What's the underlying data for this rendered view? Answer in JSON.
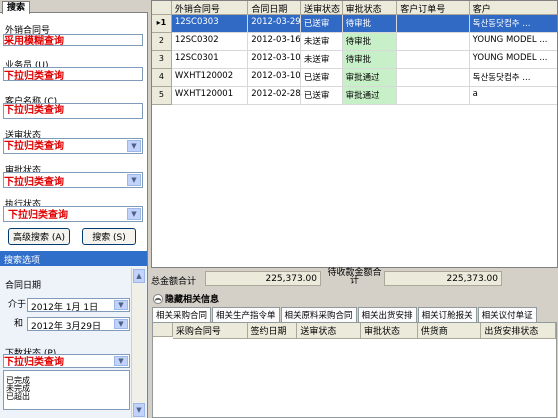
{
  "left": {
    "tab_label": "搜索",
    "fields": [
      {
        "label": "外销合同号",
        "value": "采用模糊查询"
      },
      {
        "label": "业务员 (U)",
        "value": "下拉归类查询"
      },
      {
        "label": "客户名称 (C)",
        "value": "下拉归类查询"
      },
      {
        "label": "送审状态",
        "value": "下拉归类查询"
      },
      {
        "label": "审批状态",
        "value": "下拉归类查询"
      },
      {
        "label": "执行状态",
        "value": "下拉归类查询"
      }
    ],
    "advanced_button": "高级搜索 (A)",
    "search_button": "搜索 (S)",
    "options_header": "搜索选项",
    "contract_date_label": "合同日期",
    "from_label": "介于",
    "from_date": "2012年 1月 1日",
    "to_label": "和",
    "to_date": "2012年 3月29日",
    "order_status_label": "下数状态 (P)",
    "order_status_value": "下拉归类查询",
    "order_status_options": [
      "已完成",
      "未完成",
      "已超出"
    ]
  },
  "grid": {
    "columns": [
      "外销合同号",
      "合同日期",
      "送审状态",
      "审批状态",
      "客户订单号",
      "客户"
    ],
    "rows": [
      {
        "num": "1",
        "contract": "12SC0303",
        "date": "2012-03-29",
        "submit": "已送审",
        "approve": "待审批",
        "order": "",
        "customer": "독산동닷컴추 ...",
        "selected": true
      },
      {
        "num": "2",
        "contract": "12SC0302",
        "date": "2012-03-16",
        "submit": "未送审",
        "approve": "待审批",
        "order": "",
        "customer": "YOUNG MODEL ...",
        "selected": false
      },
      {
        "num": "3",
        "contract": "12SC0301",
        "date": "2012-03-10",
        "submit": "未送审",
        "approve": "待审批",
        "order": "",
        "customer": "YOUNG MODEL ...",
        "selected": false
      },
      {
        "num": "4",
        "contract": "WXHT120002",
        "date": "2012-03-10",
        "submit": "已送审",
        "approve": "审批通过",
        "order": "",
        "customer": "독산동닷컴추 ...",
        "selected": false
      },
      {
        "num": "5",
        "contract": "WXHT120001",
        "date": "2012-02-28",
        "submit": "已送审",
        "approve": "审批通过",
        "order": "",
        "customer": "a",
        "selected": false
      }
    ]
  },
  "totals": {
    "total_label": "总金额合计",
    "total_value": "225,373.00",
    "receivable_label": "待收款金额合计",
    "receivable_value": "225,373.00"
  },
  "related": {
    "toggle_label": "隐藏相关信息",
    "tabs": [
      "相关采购合同",
      "相关生产指令单",
      "相关原料采购合同",
      "相关出货安排",
      "相关订舱报关",
      "相关议付单证"
    ],
    "columns": [
      "采购合同号",
      "签约日期",
      "送审状态",
      "审批状态",
      "供货商",
      "出货安排状态"
    ]
  },
  "colors": {
    "selected_row": "#316ac5",
    "approval_green": "#c8f0c8",
    "options_header_bg": "#2f6ec9"
  }
}
